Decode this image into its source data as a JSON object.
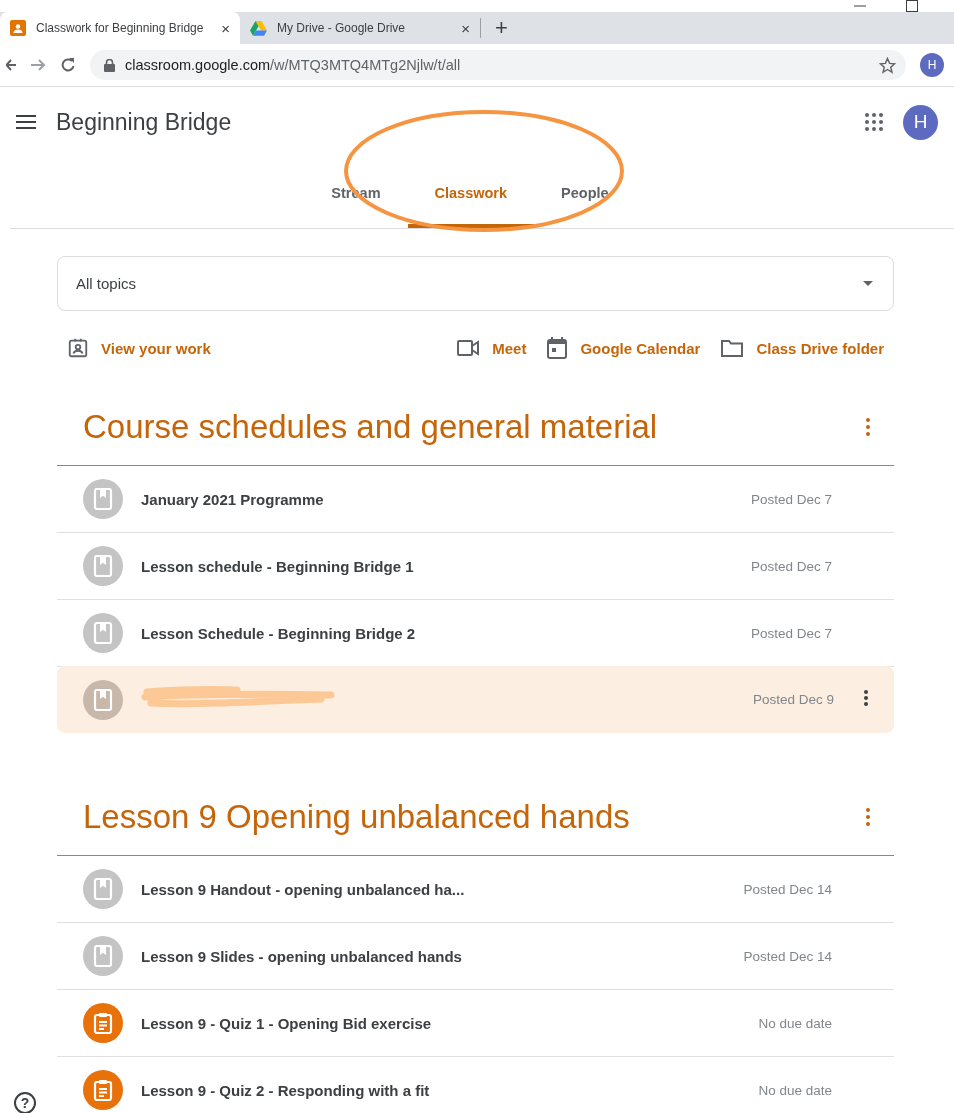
{
  "browser": {
    "tabs": [
      {
        "title": "Classwork for Beginning Bridge",
        "selected": true,
        "close": "×"
      },
      {
        "title": "My Drive - Google Drive",
        "selected": false,
        "close": "×"
      }
    ],
    "new_tab": "+",
    "url_host": "classroom.google.com",
    "url_path": "/w/MTQ3MTQ4MTg2Njlw/t/all",
    "profile": "H"
  },
  "app": {
    "title": "Beginning Bridge",
    "avatar": "H"
  },
  "class_tabs": [
    {
      "label": "Stream",
      "selected": false
    },
    {
      "label": "Classwork",
      "selected": true
    },
    {
      "label": "People",
      "selected": false
    }
  ],
  "annotation": {
    "kind": "ellipse",
    "color": "#f59542"
  },
  "topics": {
    "value": "All topics"
  },
  "view_work": {
    "label": "View your work"
  },
  "links": [
    {
      "label": "Meet"
    },
    {
      "label": "Google Calendar"
    },
    {
      "label": "Class Drive folder"
    }
  ],
  "sections": [
    {
      "title": "Course schedules and general material",
      "items": [
        {
          "kind": "material",
          "title": "January 2021 Programme",
          "posted": "Posted Dec 7",
          "highlighted": false,
          "redacted": false
        },
        {
          "kind": "material",
          "title": "Lesson schedule - Beginning Bridge 1",
          "posted": "Posted Dec 7",
          "highlighted": false,
          "redacted": false
        },
        {
          "kind": "material",
          "title": "Lesson Schedule - Beginning Bridge 2",
          "posted": "Posted Dec 7",
          "highlighted": false,
          "redacted": false
        },
        {
          "kind": "material",
          "posted": "Posted Dec 9",
          "highlighted": true,
          "redacted": true
        }
      ]
    },
    {
      "title": "Lesson 9 Opening unbalanced hands",
      "items": [
        {
          "kind": "material",
          "title": "Lesson 9 Handout - opening unbalanced ha...",
          "posted": "Posted Dec 14",
          "highlighted": false,
          "redacted": false
        },
        {
          "kind": "material",
          "title": "Lesson 9 Slides - opening unbalanced hands",
          "posted": "Posted Dec 14",
          "highlighted": false,
          "redacted": false
        },
        {
          "kind": "assignment",
          "title": "Lesson 9 - Quiz 1 - Opening Bid exercise",
          "posted": "No due date",
          "highlighted": false,
          "redacted": false
        },
        {
          "kind": "assignment",
          "title": "Lesson 9 - Quiz 2 - Responding with a fit",
          "posted": "No due date",
          "highlighted": false,
          "redacted": false
        }
      ]
    }
  ],
  "help": "?"
}
